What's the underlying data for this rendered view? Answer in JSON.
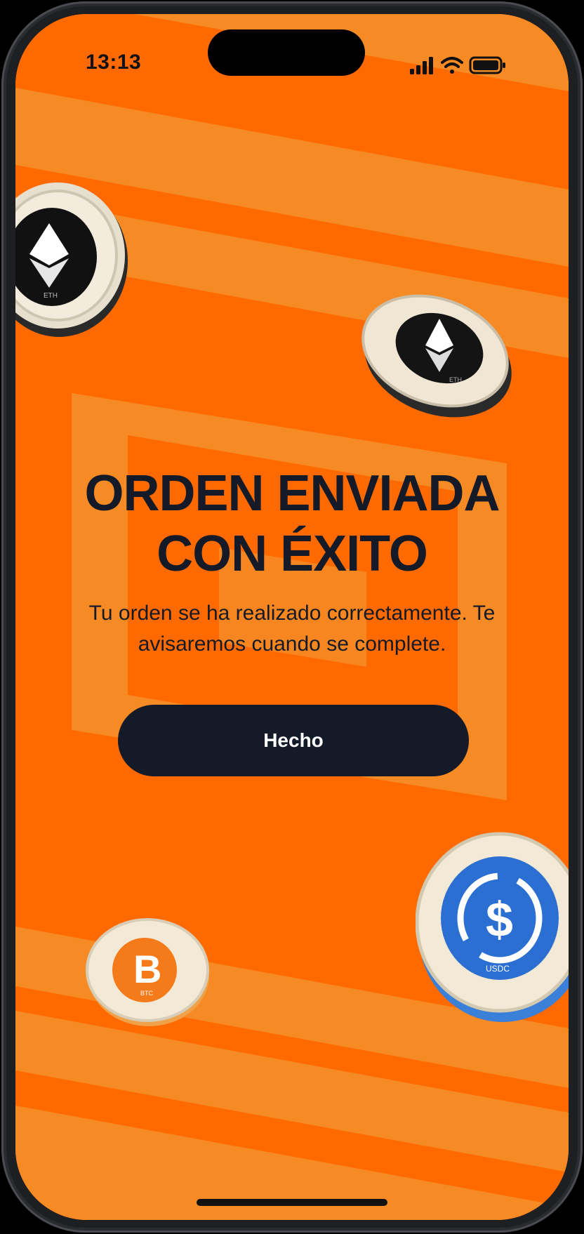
{
  "status_bar": {
    "time": "13:13",
    "icons": [
      "cellular-signal-icon",
      "wifi-icon",
      "battery-icon"
    ]
  },
  "coins": [
    {
      "name": "eth-coin",
      "symbol": "ETH"
    },
    {
      "name": "eth-coin",
      "symbol": "ETH"
    },
    {
      "name": "btc-coin",
      "symbol": "BTC"
    },
    {
      "name": "usdc-coin",
      "symbol": "USDC"
    }
  ],
  "main": {
    "title_line_1": "ORDEN ENVIADA",
    "title_line_2": "CON ÉXITO",
    "subtitle_line_1": "Tu orden se ha realizado correctamente. Te",
    "subtitle_line_2": "avisaremos cuando se complete.",
    "done_button_label": "Hecho"
  },
  "colors": {
    "background_orange": "#ff6a00",
    "stripe_light_orange": "#f68a24",
    "text_dark": "#141a27",
    "button_bg": "#141a27",
    "button_text": "#ffffff",
    "usdc_blue": "#2a6fd1",
    "btc_orange": "#f7931a"
  }
}
